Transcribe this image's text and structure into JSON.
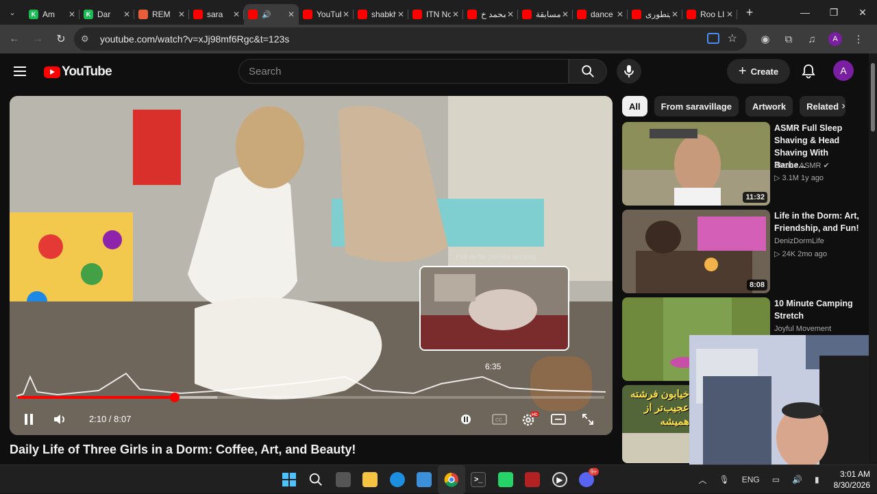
{
  "browser": {
    "tabs": [
      {
        "label": "Am",
        "fav_color": "#1db954",
        "fav_text": "K",
        "active": false
      },
      {
        "label": "Dar",
        "fav_color": "#1db954",
        "fav_text": "K",
        "active": false
      },
      {
        "label": "REM",
        "fav_color": "#e85d3a",
        "fav_text": "",
        "active": false
      },
      {
        "label": "sara",
        "fav_color": "#ff0000",
        "fav_text": "",
        "active": false
      },
      {
        "label": "",
        "fav_color": "#ff0000",
        "fav_text": "",
        "active": true,
        "speaker": "🔊"
      },
      {
        "label": "YouTube",
        "fav_color": "#ff0000",
        "fav_text": "",
        "active": false
      },
      {
        "label": "shabkhi",
        "fav_color": "#ff0000",
        "fav_text": "",
        "active": false
      },
      {
        "label": "ITN Nov",
        "fav_color": "#ff0000",
        "fav_text": "",
        "active": false
      },
      {
        "label": "محمد خ",
        "fav_color": "#ff0000",
        "fav_text": "",
        "active": false
      },
      {
        "label": "مسابقة",
        "fav_color": "#ff0000",
        "fav_text": "",
        "active": false
      },
      {
        "label": "dance s",
        "fav_color": "#ff0000",
        "fav_text": "",
        "active": false
      },
      {
        "label": "اینطوری",
        "fav_color": "#ff0000",
        "fav_text": "",
        "active": false
      },
      {
        "label": "Roo LIN",
        "fav_color": "#ff0000",
        "fav_text": "",
        "active": false
      }
    ],
    "url": "youtube.com/watch?v=xJj98mf6Rgc&t=123s"
  },
  "youtube": {
    "logo_text": "YouTube",
    "search_placeholder": "Search",
    "create_label": "Create",
    "avatar_letter": "A"
  },
  "player": {
    "seek_hint": "⌃ Pull up for precise seeking",
    "preview_time": "6:35",
    "current_time": "2:10",
    "duration": "8:07",
    "time_display": "2:10 / 8:07",
    "played_fraction": 0.267,
    "buffered_fraction": 0.34,
    "hover_fraction": 0.81
  },
  "video_title": "Daily Life of Three Girls in a Dorm: Coffee, Art, and Beauty!",
  "chips": [
    "All",
    "From saravillage",
    "Artwork",
    "Related"
  ],
  "recommendations": [
    {
      "title": "ASMR Full Sleep Shaving & Head Shaving With Barbe...",
      "channel": "Shams ASMR",
      "verified": true,
      "meta": "▷ 3.1M  1y ago",
      "duration": "11:32"
    },
    {
      "title": "Life in the Dorm: Art, Friendship, and Fun!",
      "channel": "DenizDormLife",
      "verified": false,
      "meta": "▷ 24K  2mo ago",
      "duration": "8:08"
    },
    {
      "title": "10 Minute Camping Stretch",
      "channel": "Joyful Movement",
      "verified": false,
      "meta": "",
      "duration": ""
    }
  ],
  "overlay_thumb_text": "خیابون فرشته عجیب‌تر از همیشه",
  "taskbar": {
    "lang": "ENG",
    "time": "3:01 AM",
    "date": "8/30/2026",
    "discord_badge": "9+"
  },
  "colors": {
    "accent": "#ff0000",
    "bg": "#0f0f0f",
    "chip": "#272727"
  }
}
